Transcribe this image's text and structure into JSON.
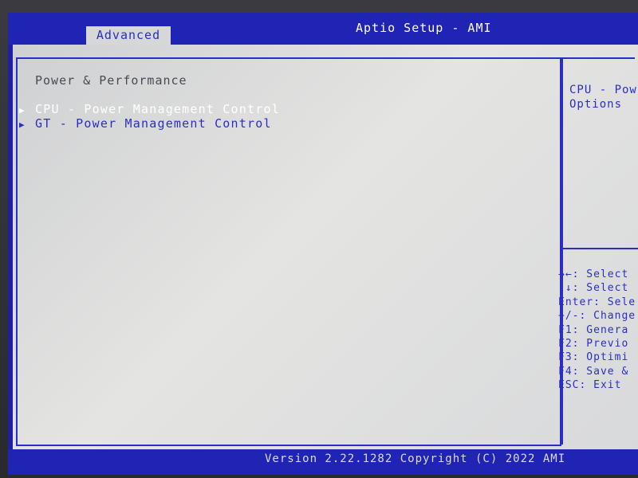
{
  "header": {
    "app_title": "Aptio Setup - AMI",
    "active_tab": "Advanced"
  },
  "main": {
    "section_title": "Power & Performance",
    "items": [
      {
        "label": "CPU - Power Management Control",
        "selected": true,
        "icon": "submenu-triangle-icon"
      },
      {
        "label": "GT - Power Management Control",
        "selected": false,
        "icon": "submenu-triangle-icon"
      }
    ]
  },
  "help": {
    "line1": "CPU - Pow",
    "line2": "Options"
  },
  "keys": [
    "→←: Select",
    "↑↓: Select",
    "Enter: Sele",
    "+/-: Change",
    "F1: Genera",
    "F2: Previo",
    "F3: Optimi",
    "F4: Save &",
    "ESC: Exit"
  ],
  "footer": {
    "version": "Version 2.22.1282 Copyright (C) 2022 AMI"
  },
  "colors": {
    "frame_blue": "#2024b4",
    "item_blue": "#2a2ec4",
    "panel_gray": "#d6d7d9",
    "selected_text": "#ffffff"
  }
}
